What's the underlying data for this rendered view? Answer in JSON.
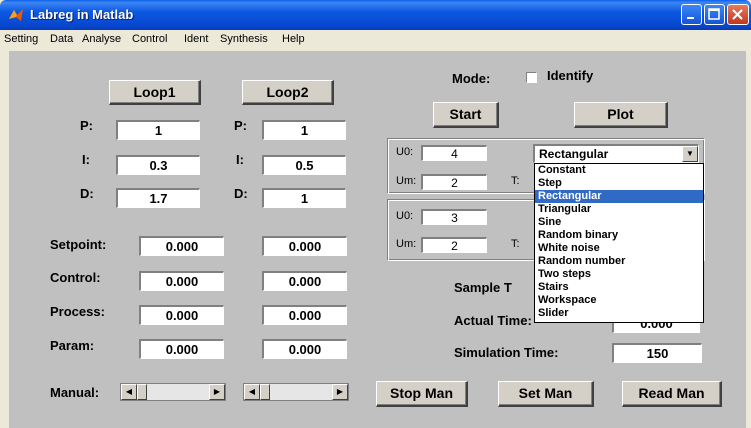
{
  "window": {
    "title": "Labreg in Matlab"
  },
  "menu": [
    "Setting",
    "Data",
    "Analyse",
    "Control",
    "Ident",
    "Synthesis",
    "Help"
  ],
  "loop1": {
    "button": "Loop1",
    "p_label": "P:",
    "p": "1",
    "i_label": "I:",
    "i": "0.3",
    "d_label": "D:",
    "d": "1.7"
  },
  "loop2": {
    "button": "Loop2",
    "p_label": "P:",
    "p": "1",
    "i_label": "I:",
    "i": "0.5",
    "d_label": "D:",
    "d": "1"
  },
  "signals": {
    "setpoint_label": "Setpoint:",
    "setpoint1": "0.000",
    "setpoint2": "0.000",
    "control_label": "Control:",
    "control1": "0.000",
    "control2": "0.000",
    "process_label": "Process:",
    "process1": "0.000",
    "process2": "0.000",
    "param_label": "Param:",
    "param1": "0.000",
    "param2": "0.000"
  },
  "manual": {
    "label": "Manual:"
  },
  "mode": {
    "label": "Mode:",
    "checkbox_label": "Identify",
    "checked": false
  },
  "actions": {
    "start": "Start",
    "plot": "Plot",
    "stop_man": "Stop Man",
    "set_man": "Set Man",
    "read_man": "Read Man"
  },
  "generator1": {
    "u0_label": "U0:",
    "u0": "4",
    "um_label": "Um:",
    "um": "2",
    "t_label": "T:",
    "waveform": "Rectangular"
  },
  "generator2": {
    "u0_label": "U0:",
    "u0": "3",
    "um_label": "Um:",
    "um": "2",
    "t_label": "T:"
  },
  "dropdown_options": [
    "Constant",
    "Step",
    "Rectangular",
    "Triangular",
    "Sine",
    "Random binary",
    "White noise",
    "Random number",
    "Two steps",
    "Stairs",
    "Workspace",
    "Slider"
  ],
  "dropdown_selected_index": 2,
  "timing": {
    "sample_label": "Sample T",
    "actual_label": "Actual Time:",
    "actual_value": "0.000",
    "simulation_label": "Simulation Time:",
    "simulation_value": "150"
  },
  "colors": {
    "titlebar": "#0b58e0",
    "figure_bg": "#c0c0c0",
    "selection": "#316ac5"
  }
}
